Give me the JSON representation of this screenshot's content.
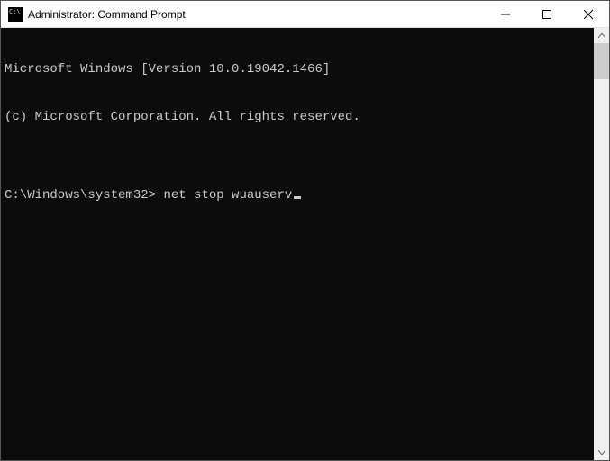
{
  "titlebar": {
    "title": "Administrator: Command Prompt",
    "icon": "cmd-icon"
  },
  "terminal": {
    "line1": "Microsoft Windows [Version 10.0.19042.1466]",
    "line2": "(c) Microsoft Corporation. All rights reserved.",
    "blank": "",
    "prompt": "C:\\Windows\\system32>",
    "command": "net stop wuauserv"
  }
}
